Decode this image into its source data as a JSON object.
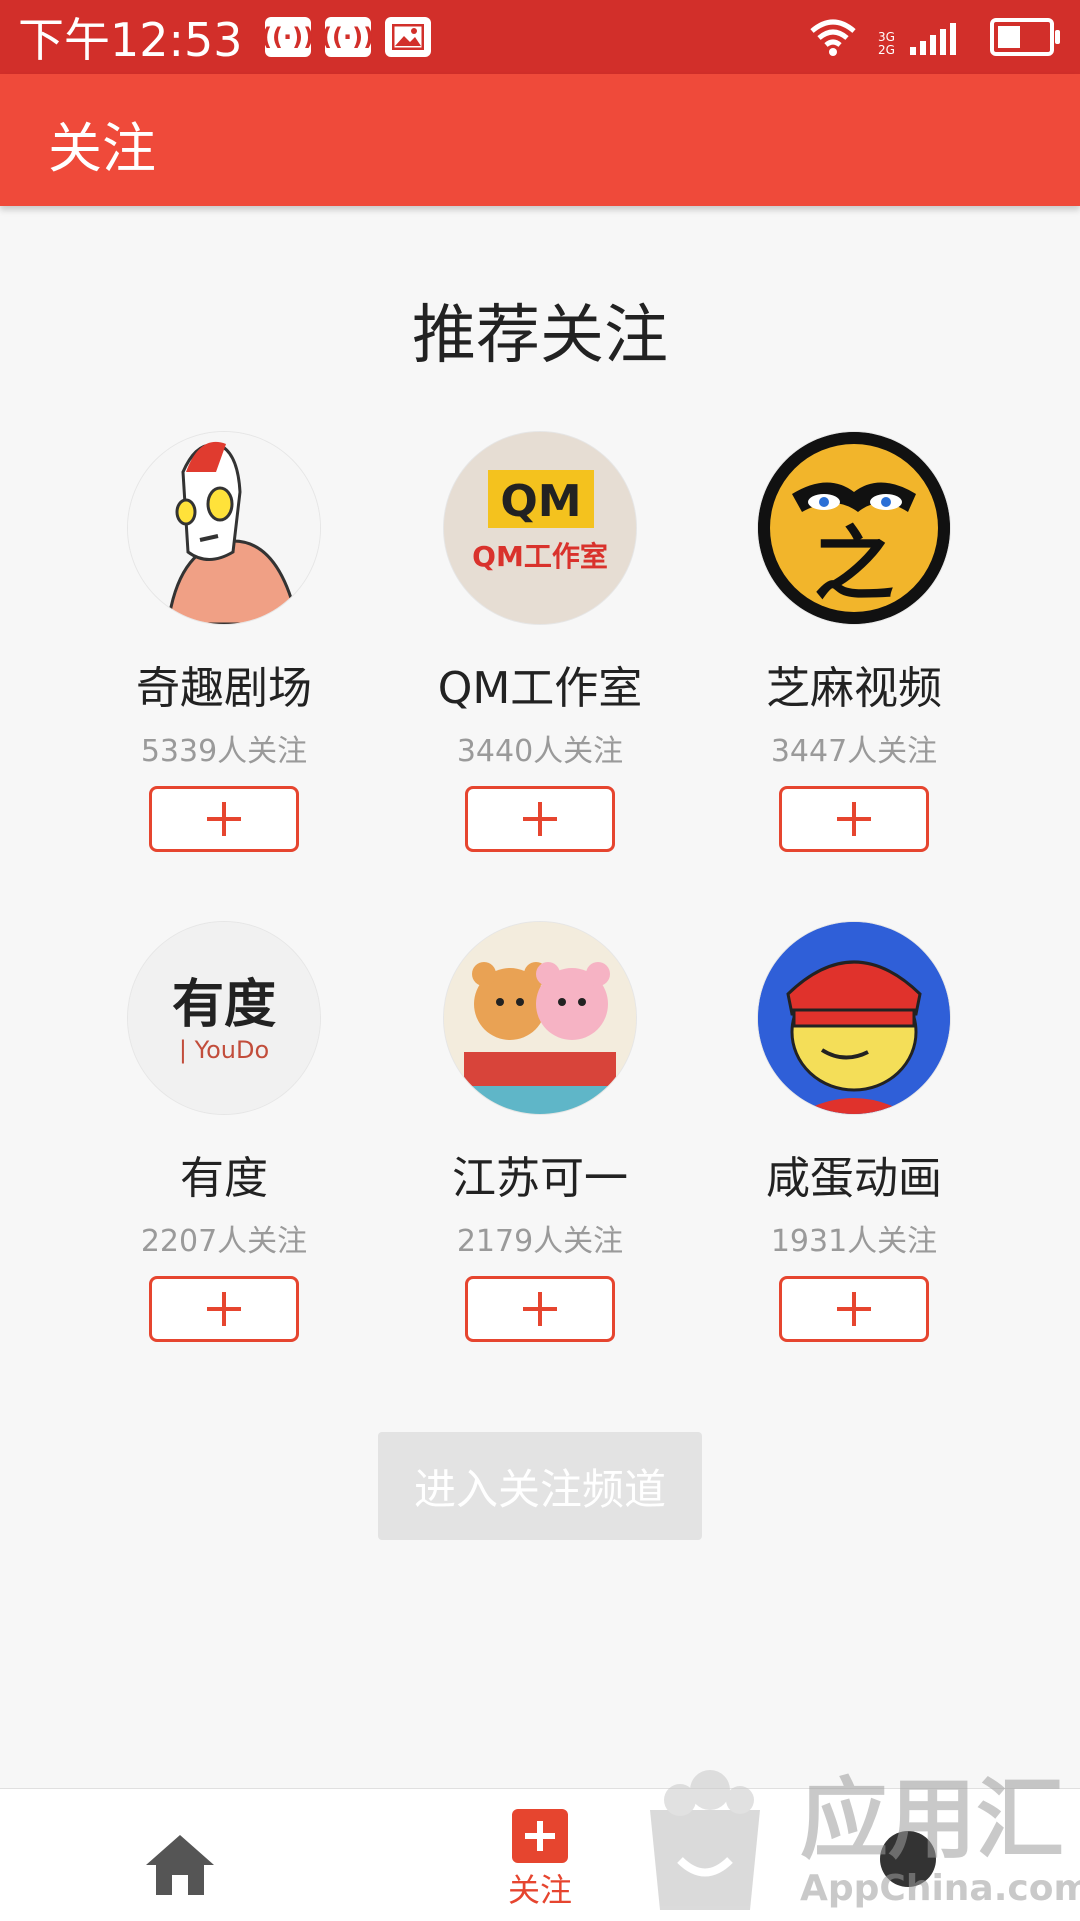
{
  "status_bar": {
    "time": "下午12:53",
    "network": "3G 2G"
  },
  "app_bar": {
    "title": "关注"
  },
  "section": {
    "title": "推荐关注"
  },
  "channels": [
    {
      "name": "奇趣剧场",
      "followers": "5339人关注",
      "avatar": "ultraman-cartoon-avatar"
    },
    {
      "name": "QM工作室",
      "followers": "3440人关注",
      "avatar": "qm-studio-logo"
    },
    {
      "name": "芝麻视频",
      "followers": "3447人关注",
      "avatar": "zhima-face-logo"
    },
    {
      "name": "有度",
      "followers": "2207人关注",
      "avatar": "youdo-logo"
    },
    {
      "name": "江苏可一",
      "followers": "2179人关注",
      "avatar": "bear-couple-avatar"
    },
    {
      "name": "咸蛋动画",
      "followers": "1931人关注",
      "avatar": "cartoon-boy-avatar"
    }
  ],
  "avatar_text": {
    "qm_logo": "QM",
    "qm_line": "QM工作室",
    "youdo_cn": "有度",
    "youdo_en": "| YouDo",
    "zhi": "之"
  },
  "enter_button": {
    "label": "进入关注频道"
  },
  "bottom_nav": {
    "follow_label": "关注"
  },
  "watermark": {
    "cn": "应用汇",
    "en": "AppChina.com"
  },
  "colors": {
    "status_bar": "#d22f2a",
    "app_bar": "#ef4a3a",
    "accent": "#e6452f",
    "disabled_button": "#e3e3e3"
  }
}
